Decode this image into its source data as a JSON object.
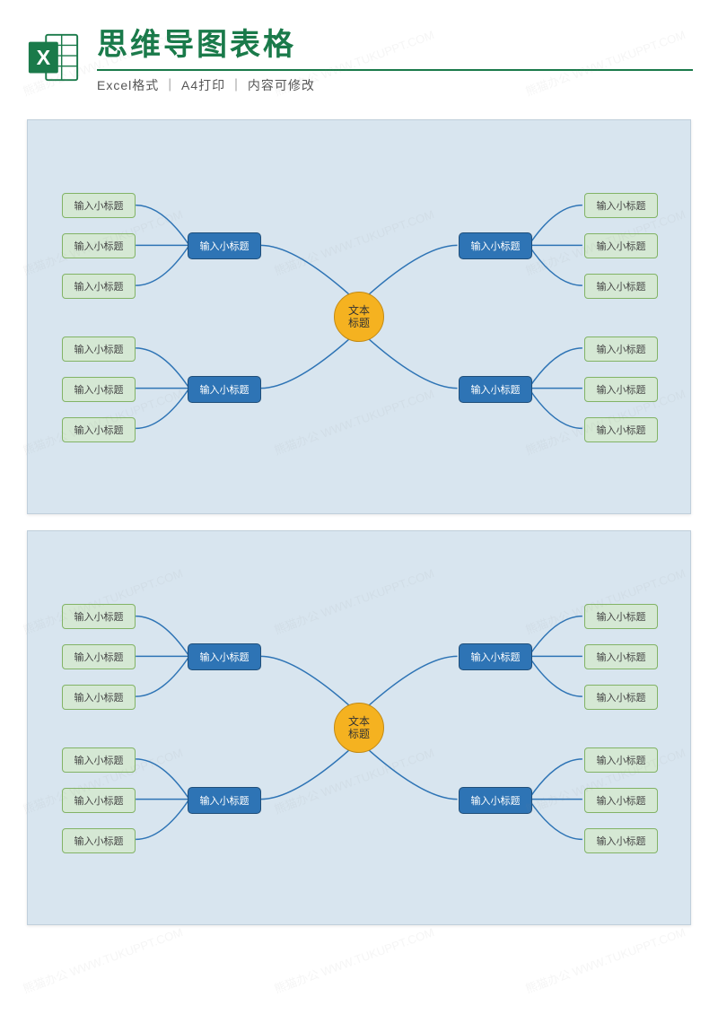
{
  "watermark": "熊猫办公 WWW.TUKUPPT.COM",
  "header": {
    "title": "思维导图表格",
    "subtitle_parts": [
      "Excel格式",
      "A4打印",
      "内容可修改"
    ],
    "icon_letter": "X"
  },
  "mindmap": {
    "center": "文本\n标题",
    "branch_label": "输入小标题",
    "leaf_label": "输入小标题",
    "colors": {
      "canvas_bg": "#d8e5ef",
      "center_fill": "#f5b220",
      "branch_fill": "#2e74b5",
      "leaf_fill": "#d5e8d4",
      "leaf_border": "#82b366"
    },
    "structure": {
      "branches": 4,
      "leaves_per_branch": 3
    }
  }
}
